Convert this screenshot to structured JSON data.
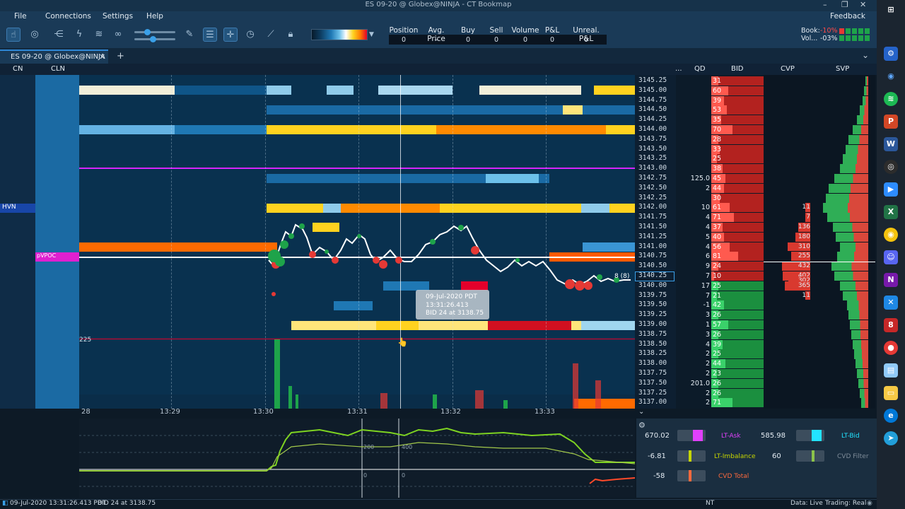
{
  "window": {
    "title": "ES 09-20 @ Globex@NINJA  -  CT Bookmap",
    "minimize": "–",
    "restore": "❐",
    "close": "✕"
  },
  "menu": {
    "file": "File",
    "connections": "Connections",
    "settings": "Settings",
    "help": "Help",
    "feedback": "Feedback"
  },
  "stats": {
    "headers": [
      "Position",
      "Avg. Price",
      "Buy",
      "Sell",
      "Volume",
      "P&L",
      "Unreal. P&L"
    ],
    "values": [
      "0",
      "–",
      "0",
      "0",
      "0",
      "0",
      "0"
    ]
  },
  "book": {
    "book_label": "Book:",
    "book_value": "-10%",
    "vol_label": "Vol...",
    "vol_value": "-03%"
  },
  "tab": {
    "label": "ES 09-20 @ Globex@NINJA",
    "close": "✕",
    "add": "+",
    "chevron": "⌄"
  },
  "columns": {
    "cn": "CN",
    "cln": "CLN",
    "more": "...",
    "qd": "QD",
    "bid": "BID",
    "cvp": "CVP",
    "svp": "SVP"
  },
  "labels": {
    "hvn": "HVN",
    "pvpoc": "pVPOC",
    "volume_scale": "225",
    "cursor_pointer": "👆"
  },
  "prices": [
    "3145.25",
    "3145.00",
    "3144.75",
    "3144.50",
    "3144.25",
    "3144.00",
    "3143.75",
    "3143.50",
    "3143.25",
    "3143.00",
    "3142.75",
    "3142.50",
    "3142.25",
    "3142.00",
    "3141.75",
    "3141.50",
    "3141.25",
    "3141.00",
    "3140.75",
    "3140.50",
    "3140.25",
    "3140.00",
    "3139.75",
    "3139.50",
    "3139.25",
    "3139.00",
    "3138.75",
    "3138.50",
    "3138.25",
    "3138.00",
    "3137.75",
    "3137.50",
    "3137.25",
    "3137.00"
  ],
  "bid_sizes": [
    "31",
    "60",
    "39",
    "53",
    "35",
    "70",
    "28",
    "33",
    "25",
    "38",
    "45",
    "44",
    "30",
    "61",
    "71",
    "37",
    "40",
    "56",
    "81",
    "24",
    "10",
    "25",
    "21",
    "42",
    "26",
    "57",
    "26",
    "39",
    "25",
    "44",
    "23",
    "26",
    "26",
    "71"
  ],
  "qd_values": [
    {
      "row": 10,
      "text": "125.0"
    },
    {
      "row": 11,
      "text": "2"
    },
    {
      "row": 13,
      "text": "10"
    },
    {
      "row": 14,
      "text": "4"
    },
    {
      "row": 15,
      "text": "4"
    },
    {
      "row": 16,
      "text": "5"
    },
    {
      "row": 17,
      "text": "4"
    },
    {
      "row": 18,
      "text": "6"
    },
    {
      "row": 19,
      "text": "9"
    },
    {
      "row": 20,
      "text": "7"
    },
    {
      "row": 21,
      "text": "17"
    },
    {
      "row": 22,
      "text": "7"
    },
    {
      "row": 23,
      "text": "-1"
    },
    {
      "row": 24,
      "text": "3"
    },
    {
      "row": 25,
      "text": "1"
    },
    {
      "row": 26,
      "text": "3"
    },
    {
      "row": 27,
      "text": "4"
    },
    {
      "row": 28,
      "text": "2"
    },
    {
      "row": 29,
      "text": "2"
    },
    {
      "row": 30,
      "text": "2"
    },
    {
      "row": 31,
      "text": "201.0"
    },
    {
      "row": 32,
      "text": "2"
    },
    {
      "row": 33,
      "text": "2"
    }
  ],
  "cvp_values": [
    {
      "row": 13,
      "text": "11"
    },
    {
      "row": 14,
      "text": "7"
    },
    {
      "row": 15,
      "text": "136"
    },
    {
      "row": 16,
      "text": "180"
    },
    {
      "row": 17,
      "text": "310"
    },
    {
      "row": 18,
      "text": "255"
    },
    {
      "row": 19,
      "text": "432"
    },
    {
      "row": 20,
      "text": "402"
    },
    {
      "row": 20.5,
      "text": "302"
    },
    {
      "row": 21,
      "text": "365"
    },
    {
      "row": 22,
      "text": "11"
    }
  ],
  "times": [
    "28",
    "13:29",
    "13:30",
    "13:31",
    "13:32",
    "13:33"
  ],
  "tooltip": {
    "line1": "09-Jul-2020 PDT",
    "line2": "13:31:26.413",
    "line3": "BID 24 at 3138.75"
  },
  "trade_tag": "8 (8)",
  "indicator": {
    "mid_value_a": "200",
    "mid_value_b": "400",
    "zero_a": "0",
    "zero_b": "0"
  },
  "controls": [
    {
      "value": "670.02",
      "label": "LT-Ask",
      "color": "#e040fb",
      "label_color": "#e040fb"
    },
    {
      "value": "585.98",
      "label": "LT-Bid",
      "color": "#22e3ff",
      "label_color": "#22e3ff"
    },
    {
      "value": "-6.81",
      "label": "LT-Imbalance",
      "color": "#c7d600",
      "label_color": "#c7d600"
    },
    {
      "value": "60",
      "label": "CVD Filter",
      "color": "#8bc34a",
      "label_color": "#7f8c99"
    },
    {
      "value": "-58",
      "label": "CVD Total",
      "color": "#ff6a3d",
      "label_color": "#ff6a3d"
    }
  ],
  "status": {
    "datetime": "09-Jul-2020 13:31:26.413 PDT",
    "info": "BID 24 at 3138.75",
    "nt": "NT",
    "data": "Data: Live",
    "trading": "Trading: Real"
  },
  "colors": {
    "accent": "#2f88d6",
    "bid": "#e53935",
    "ask": "#1ea34a",
    "hot": "#ffd21f",
    "warm": "#ff7b00"
  }
}
